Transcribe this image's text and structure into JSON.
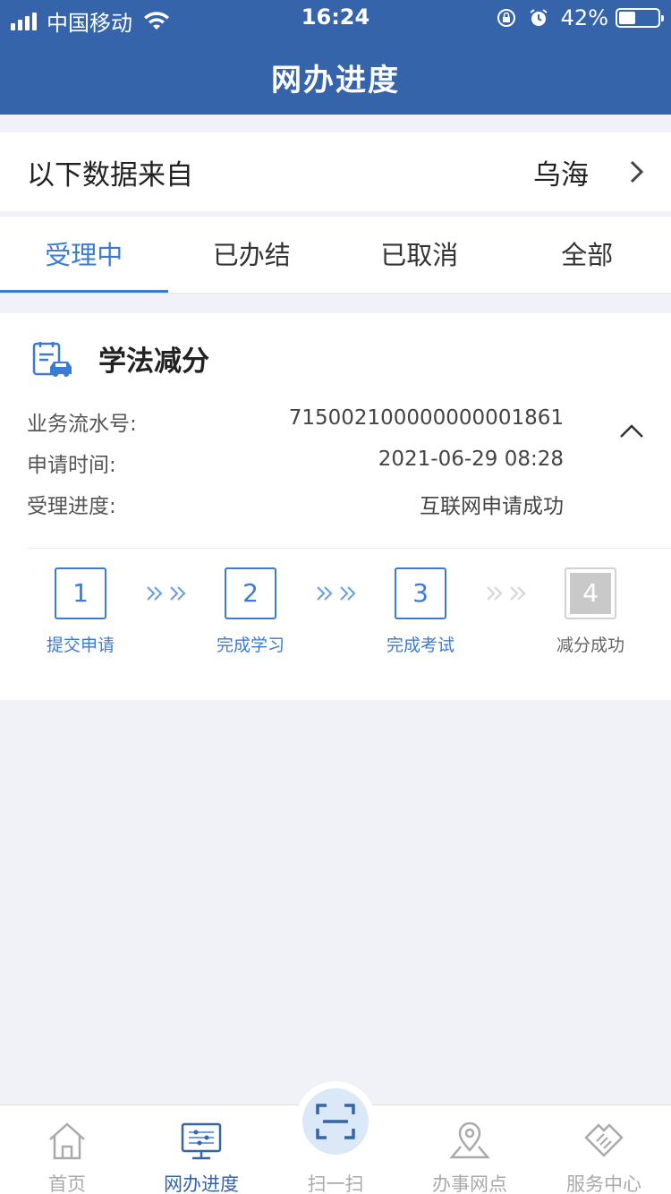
{
  "status_bar": {
    "carrier": "中国移动",
    "time": "16:24",
    "battery": "42%",
    "battery_level": 0.42
  },
  "header": {
    "title": "网办进度"
  },
  "source": {
    "label": "以下数据来自",
    "city": "乌海"
  },
  "tabs": [
    {
      "label": "受理中",
      "active": true
    },
    {
      "label": "已办结",
      "active": false
    },
    {
      "label": "已取消",
      "active": false
    },
    {
      "label": "全部",
      "active": false
    }
  ],
  "card": {
    "title": "学法减分",
    "rows": [
      {
        "key": "业务流水号:",
        "value": "715002100000000001861"
      },
      {
        "key": "申请时间:",
        "value": "2021-06-29 08:28"
      },
      {
        "key": "受理进度:",
        "value": "互联网申请成功"
      }
    ],
    "steps": [
      {
        "num": "1",
        "label": "提交申请",
        "done": true
      },
      {
        "num": "2",
        "label": "完成学习",
        "done": true
      },
      {
        "num": "3",
        "label": "完成考试",
        "done": true
      },
      {
        "num": "4",
        "label": "减分成功",
        "done": false
      }
    ]
  },
  "bottom_nav": [
    {
      "label": "首页",
      "icon": "home-icon",
      "active": false
    },
    {
      "label": "网办进度",
      "icon": "monitor-icon",
      "active": true
    },
    {
      "label": "扫一扫",
      "icon": "scan-icon",
      "active": false
    },
    {
      "label": "办事网点",
      "icon": "location-icon",
      "active": false
    },
    {
      "label": "服务中心",
      "icon": "handshake-icon",
      "active": false
    }
  ],
  "colors": {
    "header": "#3564ab",
    "accent": "#3a7bd5",
    "background": "#f1f2f7"
  }
}
